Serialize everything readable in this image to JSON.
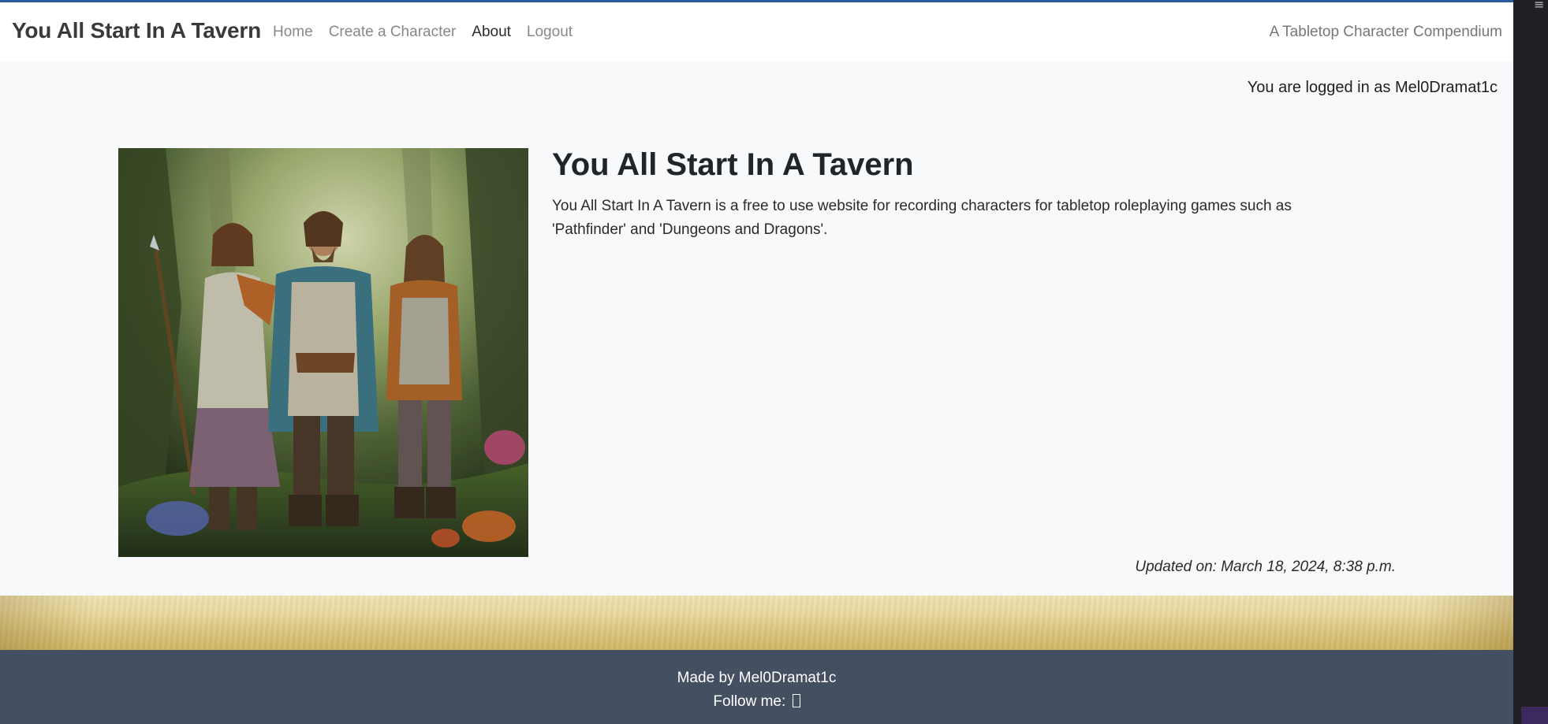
{
  "navbar": {
    "brand": "You All Start In A Tavern",
    "links": [
      "Home",
      "Create a Character",
      "About",
      "Logout"
    ],
    "active_link": "About",
    "tagline": "A Tabletop Character Compendium"
  },
  "status": {
    "login_text": "You are logged in as Mel0Dramat1c"
  },
  "content": {
    "title": "You All Start In A Tavern",
    "description": "You All Start In A Tavern is a free to use website for recording characters for tabletop roleplaying games such as 'Pathfinder' and 'Dungeons and Dragons'.",
    "updated": "Updated on: March 18, 2024, 8:38 p.m."
  },
  "footer": {
    "made_by": "Made by Mel0Dramat1c",
    "follow_label": "Follow me:",
    "follow_icon": "social-link-icon"
  },
  "colors": {
    "accent_line": "#2c5aa0",
    "footer_bg": "#444f61",
    "page_bg": "#f8f9fa",
    "parchment": "#e8d79b"
  }
}
